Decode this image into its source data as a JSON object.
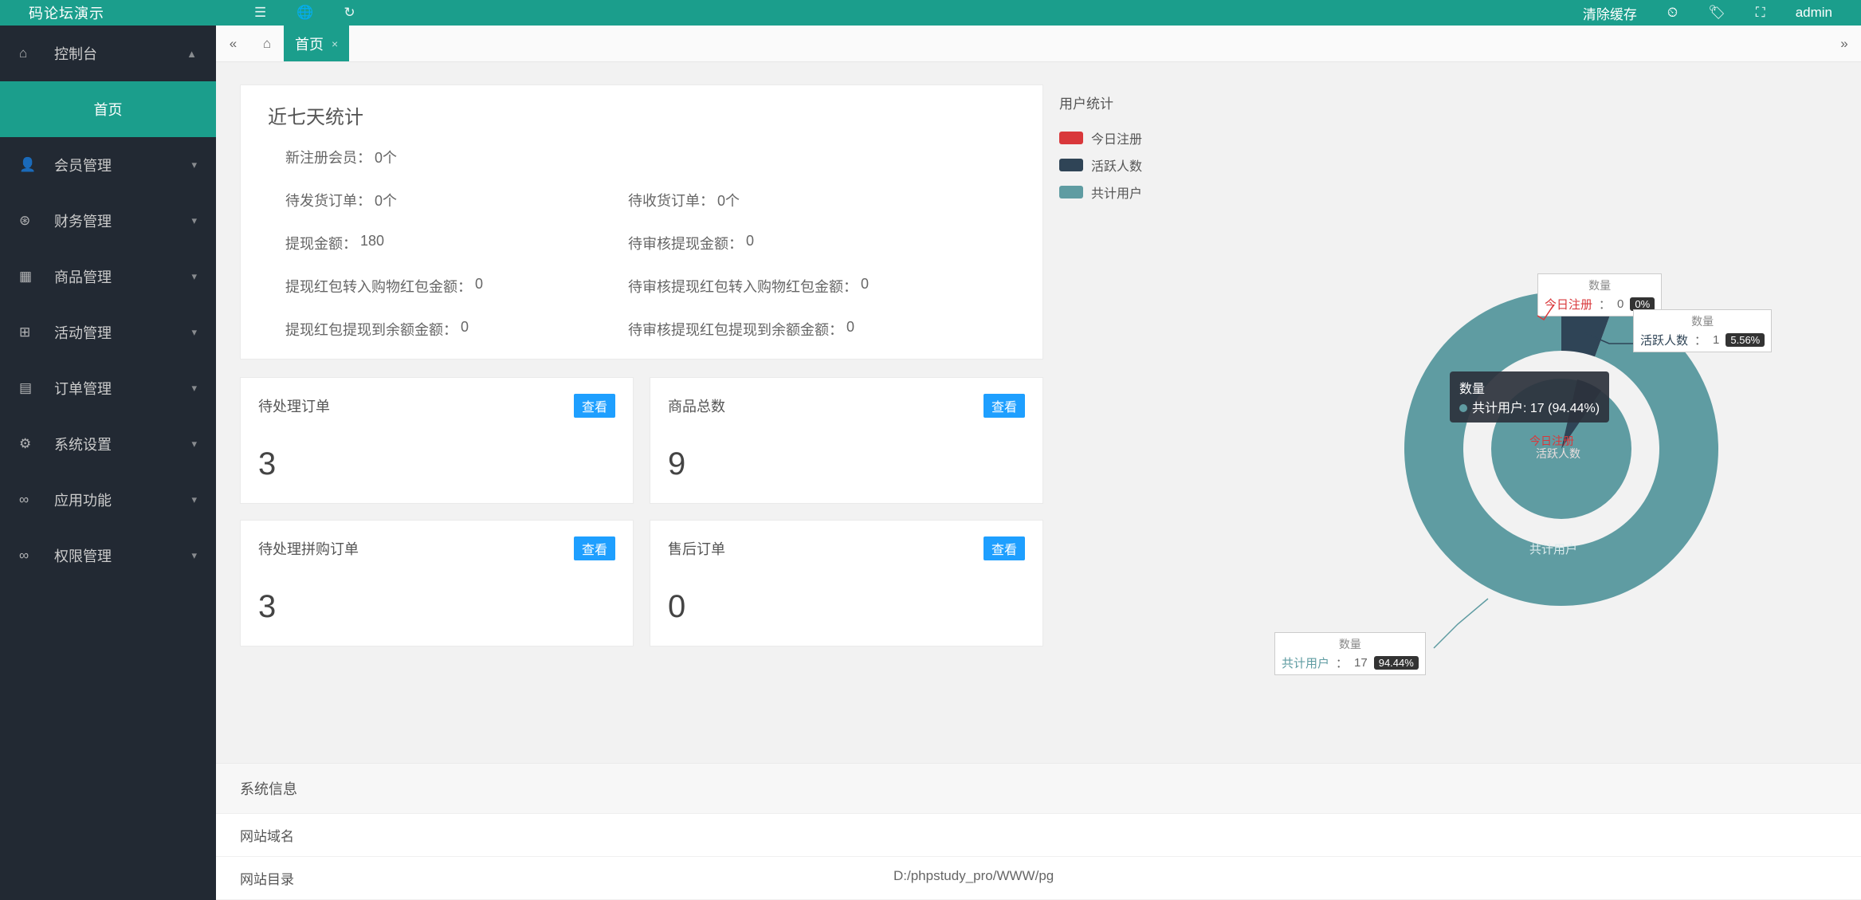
{
  "header": {
    "logo_text": "码论坛演示",
    "clear_cache": "清除缓存",
    "username": "admin"
  },
  "sidebar": {
    "items": [
      {
        "icon": "⌂",
        "label": "控制台",
        "expandable": true,
        "open": true
      },
      {
        "icon": "",
        "label": "首页",
        "active": true,
        "child": true
      },
      {
        "icon": "👤",
        "label": "会员管理",
        "expandable": true
      },
      {
        "icon": "¥",
        "label": "财务管理",
        "expandable": true
      },
      {
        "icon": "▦",
        "label": "商品管理",
        "expandable": true
      },
      {
        "icon": "⊞",
        "label": "活动管理",
        "expandable": true
      },
      {
        "icon": "▤",
        "label": "订单管理",
        "expandable": true
      },
      {
        "icon": "⚙",
        "label": "系统设置",
        "expandable": true
      },
      {
        "icon": "∞",
        "label": "应用功能",
        "expandable": true
      },
      {
        "icon": "∞",
        "label": "权限管理",
        "expandable": true
      }
    ]
  },
  "tabs": {
    "active_label": "首页"
  },
  "stats7": {
    "title": "近七天统计",
    "new_members_label": "新注册会员：",
    "new_members_val": "0个",
    "pending_ship_label": "待发货订单：",
    "pending_ship_val": "0个",
    "pending_recv_label": "待收货订单：",
    "pending_recv_val": "0个",
    "withdraw_amt_label": "提现金额：",
    "withdraw_amt_val": "180",
    "pending_withdraw_label": "待审核提现金额：",
    "pending_withdraw_val": "0",
    "red_to_cart_label": "提现红包转入购物红包金额：",
    "red_to_cart_val": "0",
    "pending_red_to_cart_label": "待审核提现红包转入购物红包金额：",
    "pending_red_to_cart_val": "0",
    "red_to_bal_label": "提现红包提现到余额金额：",
    "red_to_bal_val": "0",
    "pending_red_to_bal_label": "待审核提现红包提现到余额金额：",
    "pending_red_to_bal_val": "0"
  },
  "cards": {
    "view_label": "查看",
    "c1": {
      "title": "待处理订单",
      "value": "3"
    },
    "c2": {
      "title": "商品总数",
      "value": "9"
    },
    "c3": {
      "title": "待处理拼购订单",
      "value": "3"
    },
    "c4": {
      "title": "售后订单",
      "value": "0"
    }
  },
  "chart_data": {
    "type": "pie",
    "title": "用户统计",
    "legend_series": [
      "今日注册",
      "活跃人数",
      "共计用户"
    ],
    "colors": {
      "今日注册": "#d9383b",
      "活跃人数": "#2f4456",
      "共计用户": "#5f9ca2"
    },
    "series": [
      {
        "name": "今日注册",
        "value": 0,
        "percent": "0%"
      },
      {
        "name": "活跃人数",
        "value": 1,
        "percent": "5.56%"
      },
      {
        "name": "共计用户",
        "value": 17,
        "percent": "94.44%"
      }
    ],
    "quantity_label": "数量",
    "tooltip_text": "数量\n共计用户: 17 (94.44%)",
    "inner_labels": [
      "今日注册",
      "活跃人数",
      "共计用户"
    ]
  },
  "sysinfo": {
    "title": "系统信息",
    "rows": [
      {
        "label": "网站域名",
        "value": ""
      },
      {
        "label": "网站目录",
        "value": "D:/phpstudy_pro/WWW/pg"
      }
    ]
  }
}
